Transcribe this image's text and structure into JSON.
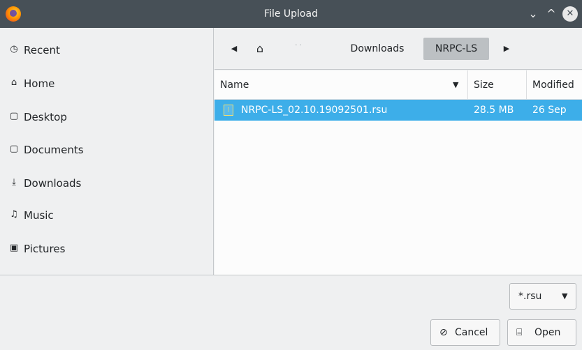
{
  "window": {
    "title": "File Upload",
    "minimize_glyph": "⌄",
    "maximize_glyph": "^",
    "close_glyph": "✕"
  },
  "sidebar": {
    "items": [
      {
        "label": "Recent",
        "icon": "clock-icon",
        "glyph": "◷"
      },
      {
        "label": "Home",
        "icon": "home-icon",
        "glyph": "⌂"
      },
      {
        "label": "Desktop",
        "icon": "desktop-icon",
        "glyph": "▢"
      },
      {
        "label": "Documents",
        "icon": "documents-icon",
        "glyph": "▢"
      },
      {
        "label": "Downloads",
        "icon": "downloads-icon",
        "glyph": "⤓"
      },
      {
        "label": "Music",
        "icon": "music-icon",
        "glyph": "♫"
      },
      {
        "label": "Pictures",
        "icon": "pictures-icon",
        "glyph": "▣"
      }
    ]
  },
  "pathbar": {
    "back_glyph": "◀",
    "home_glyph": "⌂",
    "dots": "·  ·",
    "crumbs": [
      "Downloads",
      "NRPC-LS"
    ],
    "forward_glyph": "▶"
  },
  "filelist": {
    "columns": {
      "name": "Name",
      "size": "Size",
      "modified": "Modified"
    },
    "sort_glyph": "▼",
    "rows": [
      {
        "icon": "archive-file-icon",
        "icon_glyph": "⁞",
        "name": "NRPC-LS_02.10.19092501.rsu",
        "size": "28.5 MB",
        "modified": "26 Sep",
        "selected": true
      }
    ]
  },
  "filter": {
    "value": "*.rsu",
    "caret": "▼"
  },
  "buttons": {
    "cancel": {
      "label": "Cancel",
      "icon": "cancel-icon",
      "glyph": "⊘"
    },
    "open": {
      "label": "Open",
      "icon": "folder-open-icon",
      "glyph": "⌸"
    }
  },
  "colors": {
    "titlebar": "#475057",
    "selection": "#3daee9",
    "background": "#eff0f1"
  }
}
